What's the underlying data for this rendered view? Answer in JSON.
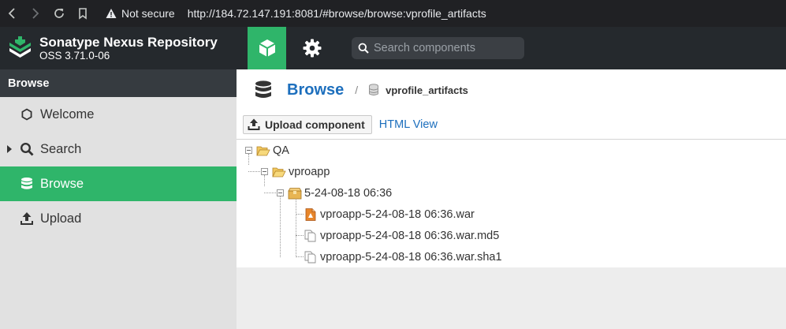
{
  "browser": {
    "security_label": "Not secure",
    "url": "http://184.72.147.191:8081/#browse/browse:vprofile_artifacts"
  },
  "app": {
    "brand_title": "Sonatype Nexus Repository",
    "brand_version": "OSS 3.71.0-06",
    "search_placeholder": "Search components"
  },
  "sidebar": {
    "heading": "Browse",
    "items": [
      {
        "label": "Welcome",
        "icon": "hexagon-icon"
      },
      {
        "label": "Search",
        "icon": "search-icon"
      },
      {
        "label": "Browse",
        "icon": "database-icon",
        "active": true
      },
      {
        "label": "Upload",
        "icon": "upload-icon"
      }
    ]
  },
  "main": {
    "title": "Browse",
    "separator": "/",
    "breadcrumb": "vprofile_artifacts",
    "upload_button": "Upload component",
    "html_view": "HTML View",
    "tree": [
      {
        "label": "QA",
        "type": "folder-open",
        "depth": 0
      },
      {
        "label": "vproapp",
        "type": "folder-open",
        "depth": 1
      },
      {
        "label": "5-24-08-18 06:36",
        "type": "package",
        "depth": 2
      },
      {
        "label": "vproapp-5-24-08-18 06:36.war",
        "type": "war-file",
        "depth": 3
      },
      {
        "label": "vproapp-5-24-08-18 06:36.war.md5",
        "type": "file",
        "depth": 3
      },
      {
        "label": "vproapp-5-24-08-18 06:36.war.sha1",
        "type": "file",
        "depth": 3
      }
    ]
  },
  "colors": {
    "accent": "#2fb56a",
    "header_bg": "#25292d",
    "link": "#1d6fbd"
  }
}
